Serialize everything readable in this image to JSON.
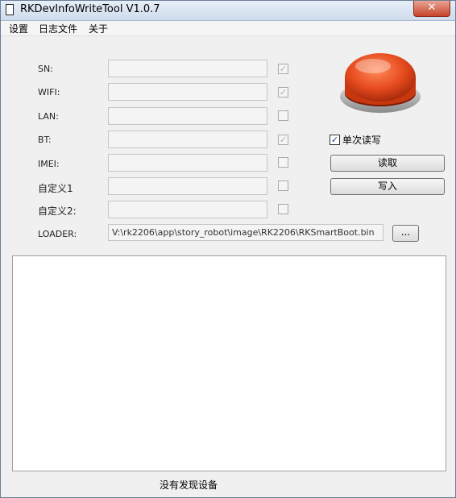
{
  "window": {
    "title": "RKDevInfoWriteTool V1.0.7",
    "close_glyph": "✕"
  },
  "menu": {
    "items": [
      "设置",
      "日志文件",
      "关于"
    ]
  },
  "fields": [
    {
      "label": "SN:",
      "value": "",
      "checked": true
    },
    {
      "label": "WIFI:",
      "value": "",
      "checked": true
    },
    {
      "label": "LAN:",
      "value": "",
      "checked": false
    },
    {
      "label": "BT:",
      "value": "",
      "checked": true
    },
    {
      "label": "IMEI:",
      "value": "",
      "checked": false
    },
    {
      "label": "自定义1",
      "value": "",
      "checked": false
    },
    {
      "label": "自定义2:",
      "value": "",
      "checked": false
    }
  ],
  "loader": {
    "label": "LOADER:",
    "path": "V:\\rk2206\\app\\story_robot\\image\\RK2206\\RKSmartBoot.bin",
    "browse_label": "..."
  },
  "controls": {
    "single_label": "单次读写",
    "single_checked": true,
    "read_label": "读取",
    "write_label": "写入"
  },
  "status": {
    "text": "没有发现设备"
  },
  "colors": {
    "button_red": "#e64a1e",
    "button_base": "#c8c8c8"
  }
}
